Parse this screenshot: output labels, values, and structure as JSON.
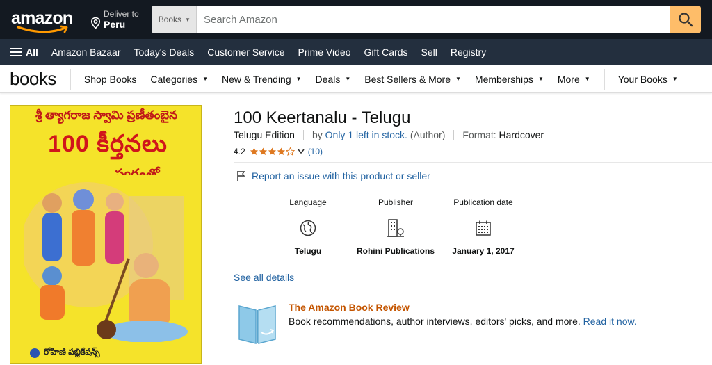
{
  "header": {
    "logo": "amazon",
    "deliver_small": "Deliver to",
    "deliver_location": "Peru",
    "search_category": "Books",
    "search_placeholder": "Search Amazon"
  },
  "nav": {
    "all": "All",
    "items": [
      "Amazon Bazaar",
      "Today's Deals",
      "Customer Service",
      "Prime Video",
      "Gift Cards",
      "Sell",
      "Registry"
    ]
  },
  "subnav": {
    "store": "books",
    "items": [
      "Shop Books",
      "Categories",
      "New & Trending",
      "Deals",
      "Best Sellers & More",
      "Memberships",
      "More"
    ],
    "your_books": "Your Books"
  },
  "cover": {
    "top_line": "శ్రీ త్యాగరాజ స్వామి ప్రణీతంబైన",
    "title": "100 కీర్తనలు",
    "subtitle": "స్వరంతో",
    "publisher_line": "రోహిణి పబ్లికేషన్స్"
  },
  "product": {
    "title": "100 Keertanalu - Telugu",
    "edition": "Telugu Edition",
    "by_prefix": "by",
    "author": "Only 1 left in stock.",
    "author_role": "(Author)",
    "format_label": "Format:",
    "format_value": "Hardcover",
    "rating": "4.2",
    "rating_value": 4.2,
    "review_count": "(10)",
    "report": "Report an issue with this product or seller",
    "see_all": "See all details"
  },
  "details": [
    {
      "label": "Language",
      "value": "Telugu",
      "icon": "globe-icon"
    },
    {
      "label": "Publisher",
      "value": "Rohini Publications",
      "icon": "building-icon"
    },
    {
      "label": "Publication date",
      "value": "January 1, 2017",
      "icon": "calendar-icon"
    }
  ],
  "book_review": {
    "title": "The Amazon Book Review",
    "text": "Book recommendations, author interviews, editors' picks, and more.",
    "link": "Read it now."
  },
  "colors": {
    "nav_dark": "#131921",
    "nav_secondary": "#232f3e",
    "search_button": "#febd69",
    "link": "#2162a1",
    "star": "#de7921",
    "review_title": "#c45500"
  }
}
